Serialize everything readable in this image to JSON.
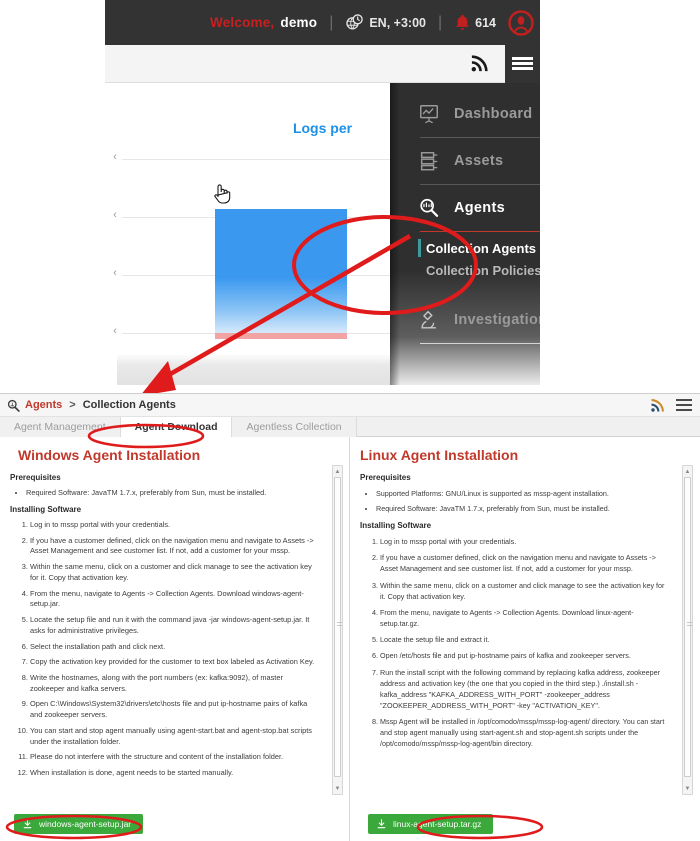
{
  "header": {
    "welcome_label": "Welcome,",
    "username": "demo",
    "separator": "|",
    "language": "EN, +3:00",
    "notification_count": "614",
    "globe_icon": "globe-clock-icon",
    "bell_icon": "bell-icon",
    "avatar_icon": "user-avatar-icon",
    "rss_icon": "rss-icon",
    "menu_icon": "hamburger-menu-icon"
  },
  "nav_menu": {
    "items": [
      {
        "label": "Dashboard",
        "icon": "dashboard-icon",
        "active": false
      },
      {
        "label": "Assets",
        "icon": "assets-server-icon",
        "active": false
      },
      {
        "label": "Agents",
        "icon": "agents-magnifier-icon",
        "active": true
      },
      {
        "label": "Investigation",
        "icon": "microscope-icon",
        "active": false
      }
    ],
    "sub_items": [
      {
        "label": "Collection Agents",
        "selected": true
      },
      {
        "label": "Collection Policies",
        "selected": false
      }
    ]
  },
  "chart_data": {
    "type": "bar",
    "title": "Logs per",
    "categories": [
      ""
    ],
    "values": [
      3
    ],
    "series": [
      {
        "name": "Logs",
        "values": [
          3
        ]
      }
    ],
    "tick_labels": [
      "",
      "",
      "",
      ""
    ],
    "ylim": [
      0,
      4
    ],
    "grid": true,
    "legend": "none",
    "xlabel": "",
    "ylabel": "",
    "bar_color": "#3a98ef",
    "baseline_color": "#f2a3a3",
    "title_color": "#1b91e8"
  },
  "page": {
    "breadcrumb": {
      "search_icon": "search-magnifier-icon",
      "root": "Agents",
      "separator": ">",
      "current": "Collection Agents",
      "rss_icon": "rss-icon",
      "menu_icon": "hamburger-menu-icon"
    },
    "tabs": [
      {
        "label": "Agent Management",
        "active": false
      },
      {
        "label": "Agent Download",
        "active": true
      },
      {
        "label": "Agentless Collection",
        "active": false
      }
    ],
    "windows": {
      "title": "Windows Agent Installation",
      "prereq_heading": "Prerequisites",
      "prereqs": [
        "Required Software: JavaTM 1.7.x, preferably from Sun, must be installed."
      ],
      "install_heading": "Installing Software",
      "steps": [
        "Log in to mssp portal with your credentials.",
        "If you have a customer defined, click on the navigation menu and navigate to Assets -> Asset Management and see customer list. If not, add a customer for your mssp.",
        "Within the same menu, click on a customer and click manage to see the activation key for it. Copy that activation key.",
        "From the menu, navigate to Agents -> Collection Agents. Download windows-agent-setup.jar.",
        "Locate the setup file and run it with the command java -jar windows-agent-setup.jar. It asks for administrative privileges.",
        "Select the installation path and click next.",
        "Copy the activation key provided for the customer to text box labeled as Activation Key.",
        "Write the hostnames, along with the port numbers (ex: kafka:9092), of master zookeeper and kafka servers.",
        "Open C:\\Windows\\System32\\drivers\\etc\\hosts file and put ip-hostname pairs of kafka and zookeeper servers.",
        "You can start and stop agent manually using agent-start.bat and agent-stop.bat scripts under the installation folder.",
        "Please do not interfere with the structure and content of the installation folder.",
        "When installation is done, agent needs to be started manually."
      ],
      "download_label": "windows-agent-setup.jar",
      "download_icon": "download-icon"
    },
    "linux": {
      "title": "Linux Agent Installation",
      "prereq_heading": "Prerequisites",
      "prereqs": [
        "Supported Platforms: GNU/Linux is supported as mssp-agent installation.",
        "Required Software: JavaTM 1.7.x, preferably from Sun, must be installed."
      ],
      "install_heading": "Installing Software",
      "steps": [
        "Log in to mssp portal with your credentials.",
        "If you have a customer defined, click on the navigation menu and navigate to Assets -> Asset Management and see customer list. If not, add a customer for your mssp.",
        "Within the same menu, click on a customer and click manage to see the activation key for it. Copy that activation key.",
        "From the menu, navigate to Agents -> Collection Agents. Download linux-agent-setup.tar.gz.",
        "Locate the setup file and extract it.",
        "Open /etc/hosts file and put ip-hostname pairs of kafka and zookeeper servers.",
        "Run the install script with the following command by replacing kafka address, zookeeper address and activation key (the one that you copied in the third step.) ./install.sh -kafka_address \"KAFKA_ADDRESS_WITH_PORT\" -zookeeper_address \"ZOOKEEPER_ADDRESS_WITH_PORT\" -key \"ACTIVATION_KEY\".",
        "Mssp Agent will be installed in /opt/comodo/mssp/mssp-log-agent/ directory. You can start and stop agent manually using start-agent.sh and stop-agent.sh scripts under the /opt/comodo/mssp/mssp-log-agent/bin directory."
      ],
      "download_label": "linux-agent-setup.tar.gz",
      "download_icon": "download-icon"
    }
  },
  "annotations": {
    "menu_highlight": "red-ellipse-around-collection-agents",
    "tab_highlight": "red-ellipse-around-agent-download-tab",
    "windows_btn_highlight": "red-ellipse-around-windows-download",
    "linux_btn_highlight": "red-ellipse-around-linux-download",
    "arrow": "red-arrow-from-menu-to-breadcrumb",
    "color": "#e01b1b"
  }
}
